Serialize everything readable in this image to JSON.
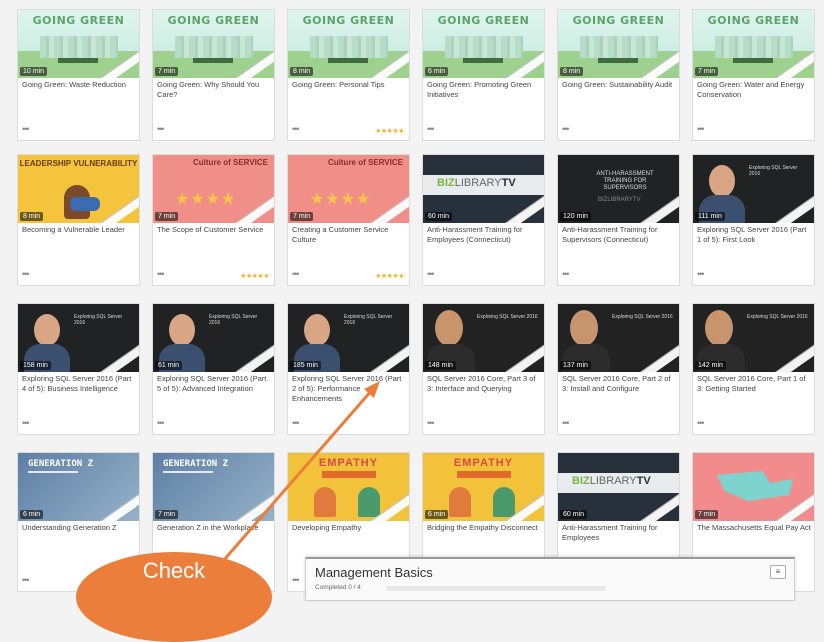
{
  "cards": [
    {
      "name": "card-going-green-waste",
      "theme": "green",
      "duration": "10 min",
      "title": "Going Green: Waste Reduction",
      "stars": ""
    },
    {
      "name": "card-going-green-why",
      "theme": "green",
      "duration": "7 min",
      "title": "Going Green: Why Should You Care?",
      "stars": ""
    },
    {
      "name": "card-going-green-personal",
      "theme": "green",
      "duration": "8 min",
      "title": "Going Green: Personal Tips",
      "stars": "★★★★★"
    },
    {
      "name": "card-going-green-promoting",
      "theme": "green",
      "duration": "6 min",
      "title": "Going Green: Promoting Green Initiatives",
      "stars": ""
    },
    {
      "name": "card-going-green-audit",
      "theme": "green",
      "duration": "8 min",
      "title": "Going Green: Sustainability Audit",
      "stars": ""
    },
    {
      "name": "card-going-green-water",
      "theme": "green",
      "duration": "7 min",
      "title": "Going Green: Water and Energy Conservation",
      "stars": ""
    },
    {
      "name": "card-vulnerable-leader",
      "theme": "yellow",
      "duration": "8 min",
      "title": "Becoming a Vulnerable Leader",
      "stars": ""
    },
    {
      "name": "card-scope-service",
      "theme": "coral",
      "duration": "7 min",
      "title": "The Scope of Customer Service",
      "stars": "★★★★★"
    },
    {
      "name": "card-service-culture",
      "theme": "coral",
      "duration": "7 min",
      "title": "Creating a Customer Service Culture",
      "stars": "★★★★★"
    },
    {
      "name": "card-harassment-employees-ct",
      "theme": "biz",
      "duration": "60 min",
      "title": "Anti-Harassment Training for Employees (Connecticut)",
      "stars": ""
    },
    {
      "name": "card-harassment-supervisors-ct",
      "theme": "dark",
      "duration": "120 min",
      "title": "Anti-Harassment Training for Supervisors (Connecticut)",
      "stars": ""
    },
    {
      "name": "card-sql-first-look",
      "theme": "person",
      "duration": "111 min",
      "title": "Exploring SQL Server 2016 (Part 1 of 5): First Look",
      "stars": ""
    },
    {
      "name": "card-sql-business-intel",
      "theme": "person",
      "duration": "158 min",
      "title": "Exploring SQL Server 2016 (Part 4 of 5): Business Intelligence",
      "stars": ""
    },
    {
      "name": "card-sql-advanced-integration",
      "theme": "person",
      "duration": "61 min",
      "title": "Exploring SQL Server 2016 (Part 5 of 5): Advanced Integration",
      "stars": ""
    },
    {
      "name": "card-sql-performance",
      "theme": "person",
      "duration": "185 min",
      "title": "Exploring SQL Server 2016 (Part 2 of 5): Performance Enhancements",
      "stars": ""
    },
    {
      "name": "card-sql-core-interface",
      "theme": "beard",
      "duration": "148 min",
      "title": "SQL Server 2016 Core, Part 3 of 3: Interface and Querying",
      "stars": ""
    },
    {
      "name": "card-sql-core-install",
      "theme": "beard",
      "duration": "137 min",
      "title": "SQL Server 2016 Core, Part 2 of 3: Install and Configure",
      "stars": ""
    },
    {
      "name": "card-sql-core-getting-started",
      "theme": "beard",
      "duration": "142 min",
      "title": "SQL Server 2016 Core, Part 1 of 3: Getting Started",
      "stars": ""
    },
    {
      "name": "card-generation-z",
      "theme": "blue",
      "duration": "6 min",
      "title": "Understanding Generation Z",
      "stars": ""
    },
    {
      "name": "card-generation-z-workplace",
      "theme": "blue",
      "duration": "7 min",
      "title": "Generation Z in the Workplace",
      "stars": ""
    },
    {
      "name": "card-developing-empathy",
      "theme": "emp",
      "duration": "",
      "title": "Developing Empathy",
      "stars": ""
    },
    {
      "name": "card-empathy-disconnect",
      "theme": "emp",
      "duration": "6 min",
      "title": "Bridging the Empathy Disconnect",
      "stars": ""
    },
    {
      "name": "card-harassment-employees",
      "theme": "biz",
      "duration": "60 min",
      "title": "Anti-Harassment Training for Employees",
      "stars": ""
    },
    {
      "name": "card-mass-equal-pay",
      "theme": "mass",
      "duration": "7 min",
      "title": "The Massachusetts Equal Pay Act",
      "stars": ""
    }
  ],
  "thumbs": {
    "going_green": "GOING GREEN",
    "leadership": "LEADERSHIP VULNERABILITY",
    "culture": "Culture of SERVICE",
    "biz_a": "BIZ",
    "biz_b": "LIBRARY",
    "biz_c": "TV",
    "supervisor_text": "ANTI-HARASSMENT TRAINING FOR SUPERVISORS",
    "gen_z": "GENERATION Z",
    "empathy": "EMPATHY",
    "sql_text": "Exploring SQL Server 2016"
  },
  "more_label": "•••",
  "management": {
    "title": "Management Basics",
    "completed": "Completed 0 / 4",
    "progress": 0,
    "menu_icon": "menu-icon"
  },
  "callout": {
    "text": "Check",
    "color": "#ec7e3b"
  }
}
